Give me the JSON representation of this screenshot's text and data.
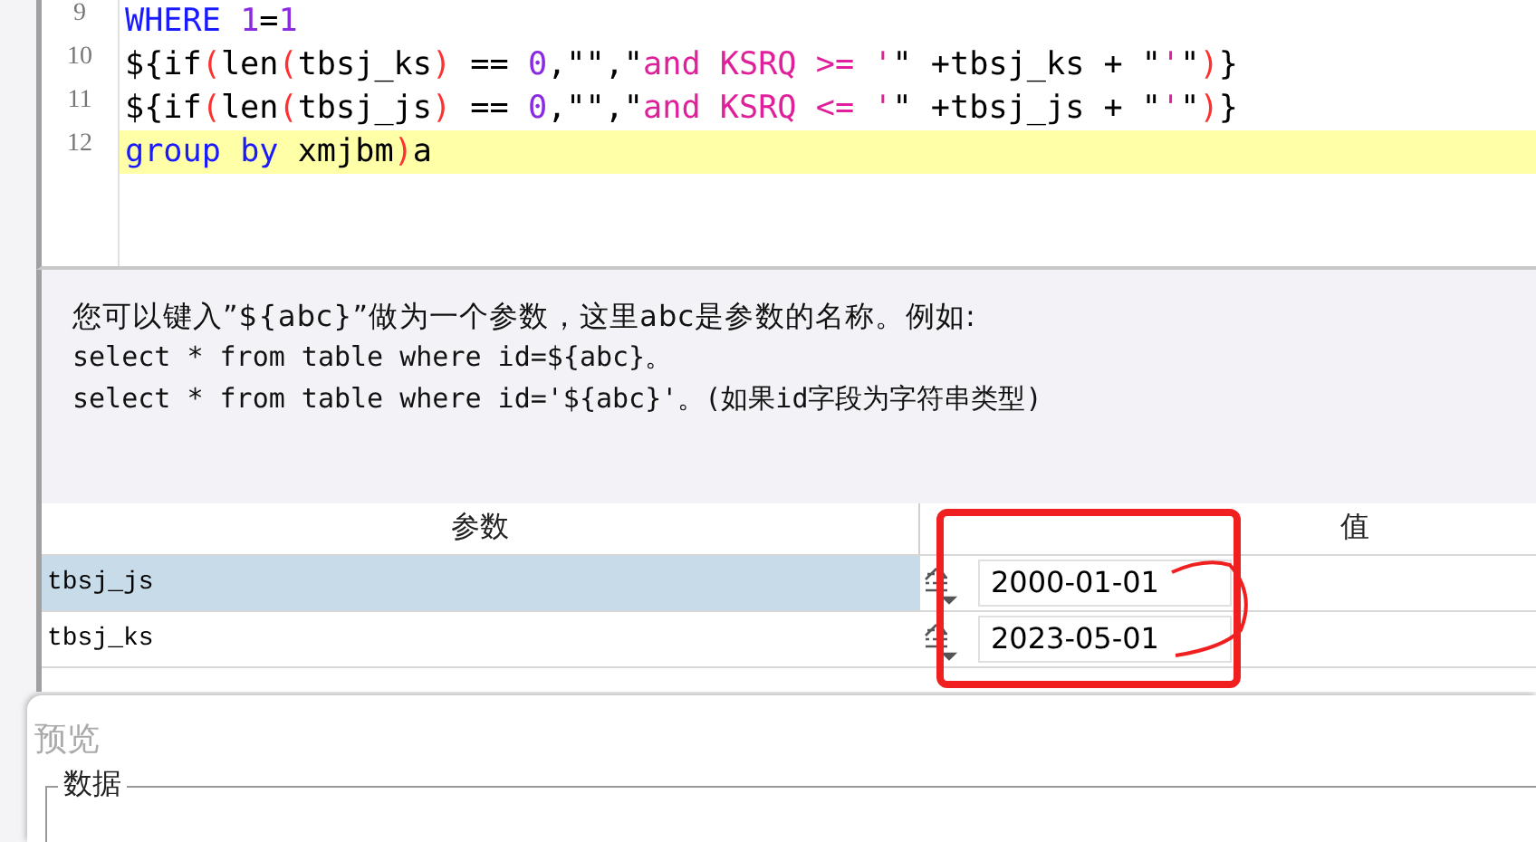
{
  "editor": {
    "lines": [
      {
        "number": "9",
        "highlighted": false,
        "tokens": [
          {
            "kind": "keyword",
            "text": "WHERE "
          },
          {
            "kind": "number",
            "text": "1"
          },
          {
            "kind": "plain",
            "text": "="
          },
          {
            "kind": "number",
            "text": "1"
          }
        ]
      },
      {
        "number": "10",
        "highlighted": false,
        "tokens": [
          {
            "kind": "plain",
            "text": "${if"
          },
          {
            "kind": "paren",
            "text": "("
          },
          {
            "kind": "plain",
            "text": "len"
          },
          {
            "kind": "paren",
            "text": "("
          },
          {
            "kind": "plain",
            "text": "tbsj_ks"
          },
          {
            "kind": "paren",
            "text": ")"
          },
          {
            "kind": "plain",
            "text": " == "
          },
          {
            "kind": "number",
            "text": "0"
          },
          {
            "kind": "plain",
            "text": ",\"\",\""
          },
          {
            "kind": "string",
            "text": "and KSRQ >= '"
          },
          {
            "kind": "plain",
            "text": "\" +tbsj_ks + \""
          },
          {
            "kind": "string",
            "text": "'"
          },
          {
            "kind": "plain",
            "text": "\""
          },
          {
            "kind": "paren",
            "text": ")"
          },
          {
            "kind": "plain",
            "text": "}"
          }
        ]
      },
      {
        "number": "11",
        "highlighted": false,
        "tokens": [
          {
            "kind": "plain",
            "text": "${if"
          },
          {
            "kind": "paren",
            "text": "("
          },
          {
            "kind": "plain",
            "text": "len"
          },
          {
            "kind": "paren",
            "text": "("
          },
          {
            "kind": "plain",
            "text": "tbsj_js"
          },
          {
            "kind": "paren",
            "text": ")"
          },
          {
            "kind": "plain",
            "text": " == "
          },
          {
            "kind": "number",
            "text": "0"
          },
          {
            "kind": "plain",
            "text": ",\"\",\""
          },
          {
            "kind": "string",
            "text": "and KSRQ <= '"
          },
          {
            "kind": "plain",
            "text": "\" +tbsj_js + \""
          },
          {
            "kind": "string",
            "text": "'"
          },
          {
            "kind": "plain",
            "text": "\""
          },
          {
            "kind": "paren",
            "text": ")"
          },
          {
            "kind": "plain",
            "text": "}"
          }
        ]
      },
      {
        "number": "12",
        "highlighted": true,
        "tokens": [
          {
            "kind": "keyword",
            "text": "group "
          },
          {
            "kind": "keyword",
            "text": "by "
          },
          {
            "kind": "plain",
            "text": "xmjbm"
          },
          {
            "kind": "paren",
            "text": ")"
          },
          {
            "kind": "plain",
            "text": "a"
          }
        ]
      }
    ]
  },
  "help": {
    "lines": [
      "您可以键入”${abc}”做为一个参数，这里abc是参数的名称。例如:",
      "select * from table where id=${abc}。",
      "select * from table where id='${abc}'。(如果id字段为字符串类型)"
    ]
  },
  "params": {
    "columns": [
      "参数",
      "值"
    ],
    "rows": [
      {
        "name": "tbsj_js",
        "value": "2000-01-01",
        "selected": true
      },
      {
        "name": "tbsj_ks",
        "value": "2023-05-01",
        "selected": false
      }
    ]
  },
  "preview": {
    "title": "预览",
    "group": "数据"
  }
}
